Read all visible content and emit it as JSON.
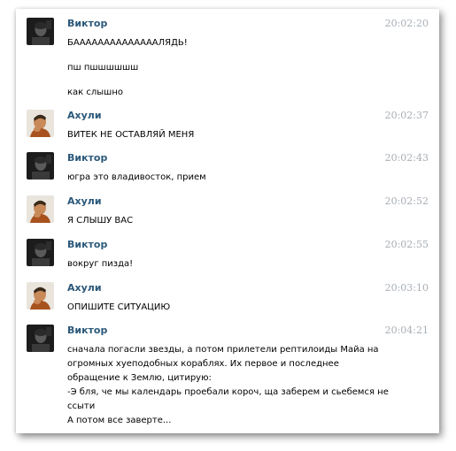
{
  "messages": [
    {
      "author": "Виктор",
      "avatar": "viktor",
      "time": "20:02:20",
      "lines": [
        "БААААААААААААААЛЯДЬ!",
        "пш пшшшшшш",
        "как слышно"
      ]
    },
    {
      "author": "Ахули",
      "avatar": "akhuli",
      "time": "20:02:37",
      "lines": [
        "ВИТЕК НЕ ОСТАВЛЯЙ МЕНЯ"
      ]
    },
    {
      "author": "Виктор",
      "avatar": "viktor",
      "time": "20:02:43",
      "lines": [
        "югра это владивосток, прием"
      ]
    },
    {
      "author": "Ахули",
      "avatar": "akhuli",
      "time": "20:02:52",
      "lines": [
        "Я СЛЫШУ ВАС"
      ]
    },
    {
      "author": "Виктор",
      "avatar": "viktor",
      "time": "20:02:55",
      "lines": [
        "вокруг пизда!"
      ]
    },
    {
      "author": "Ахули",
      "avatar": "akhuli",
      "time": "20:03:10",
      "lines": [
        "ОПИШИТЕ СИТУАЦИЮ"
      ]
    },
    {
      "author": "Виктор",
      "avatar": "viktor",
      "time": "20:04:21",
      "lines": [
        "сначала погасли звезды, а потом прилетели рептилоиды Майа на",
        "огромных хуеподобных кораблях. Их первое и последнее",
        "обращение к Землю, цитирую:",
        "-Э бля, че мы календарь проебали короч, ща заберем и сьебемся не",
        "ссыти",
        "А потом все заверте..."
      ]
    }
  ]
}
